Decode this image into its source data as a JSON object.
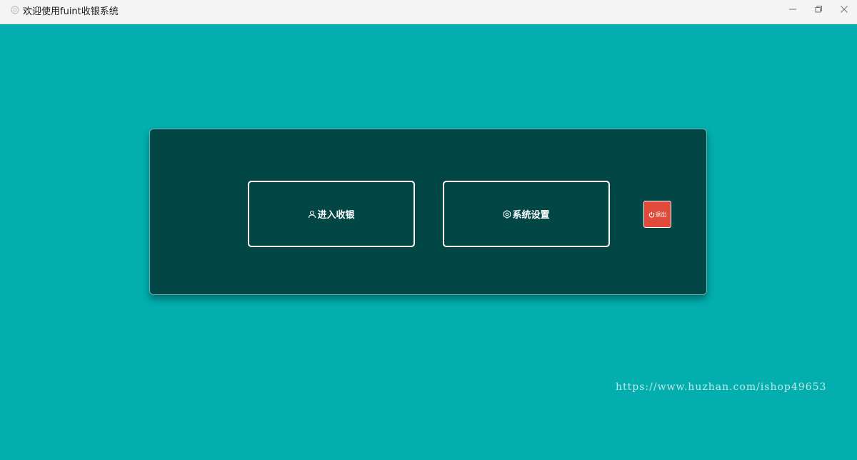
{
  "window": {
    "title": "欢迎使用fuint收银系统",
    "app_icon": "gear-app-icon",
    "controls": [
      "minimize-icon",
      "restore-icon",
      "close-icon"
    ]
  },
  "colors": {
    "background": "#02aeae",
    "panel": "#034646",
    "exit": "#e04a3b"
  },
  "panel": {
    "enter_cashier": {
      "label": "进入收银",
      "icon": "user-icon"
    },
    "system_settings": {
      "label": "系统设置",
      "icon": "gear-icon"
    },
    "exit": {
      "label": "退出",
      "icon": "power-icon"
    }
  },
  "watermark": "https://www.huzhan.com/ishop49653"
}
